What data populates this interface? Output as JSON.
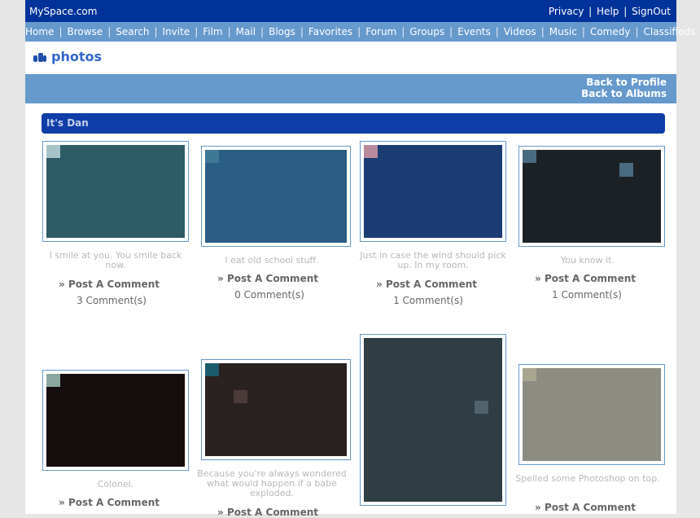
{
  "header": {
    "brand": "MySpace.com",
    "links": [
      "Privacy",
      "Help",
      "SignOut"
    ]
  },
  "nav": [
    "Home",
    "Browse",
    "Search",
    "Invite",
    "Film",
    "Mail",
    "Blogs",
    "Favorites",
    "Forum",
    "Groups",
    "Events",
    "Videos",
    "Music",
    "Comedy",
    "Classifieds"
  ],
  "section_title": "photos",
  "back_links": [
    "Back to Profile",
    "Back to Albums"
  ],
  "album_name": "It's Dan",
  "post_comment_label": "» Post A Comment",
  "photos": [
    {
      "caption": "I smile at you. You smile back now.",
      "comments": "3 Comment(s)",
      "palette": [
        "#2d5b66",
        "#6f9b88",
        "#a6c4c8",
        "#173d52",
        "#e38d84",
        "#f2d09a",
        "#111a1e",
        "#9bb2b5"
      ]
    },
    {
      "caption": "I eat old school stuff.",
      "comments": "0 Comment(s)",
      "palette": [
        "#2a5d83",
        "#5e8fad",
        "#a9bfd0",
        "#1c1a1d",
        "#7a6a67",
        "#c7c7c1",
        "#e6e3df",
        "#3f7895"
      ]
    },
    {
      "caption": "Just in case the wind should pick up. In my room.",
      "comments": "1 Comment(s)",
      "palette": [
        "#1b3d73",
        "#14506a",
        "#6f95b1",
        "#0f2b3a",
        "#b88a9e",
        "#cab7a8",
        "#e0d8c5",
        "#2d4b65"
      ]
    },
    {
      "caption": "You know it.",
      "comments": "1 Comment(s)",
      "palette": [
        "#1c2126",
        "#4a6a7f",
        "#7b7f86",
        "#2a1e1b",
        "#c48570",
        "#cfc5b4",
        "#8da0b7",
        "#40525f"
      ]
    },
    {
      "caption": "Colonel.",
      "comments": "",
      "palette": [
        "#150d0e",
        "#3a1c1a",
        "#7a4438",
        "#2b6d56",
        "#c0a0a4",
        "#4b7f6c",
        "#8aa8a0",
        "#201411"
      ]
    },
    {
      "caption": "Because you're always wondered what would happen if a babe exploded.",
      "comments": "",
      "palette": [
        "#2a2221",
        "#4b3c3a",
        "#a7705b",
        "#1b5c6b",
        "#6e5e5a",
        "#3a2b29",
        "#85736e",
        "#241b1a"
      ]
    },
    {
      "caption": "",
      "comments": "",
      "palette": [
        "#2f3d44",
        "#50626b",
        "#a9b5bd",
        "#e2e7ea",
        "#c9b8a2",
        "#7e8a8e",
        "#1d262b",
        "#efe7dc"
      ]
    },
    {
      "caption": "Spelled some Photoshop on top.",
      "comments": "",
      "palette": [
        "#8c8c83",
        "#c8c4ae",
        "#e8e4cc",
        "#6f6f63",
        "#d9c46b",
        "#a8a68f",
        "#f0eee1",
        "#bdb8a0"
      ]
    }
  ]
}
